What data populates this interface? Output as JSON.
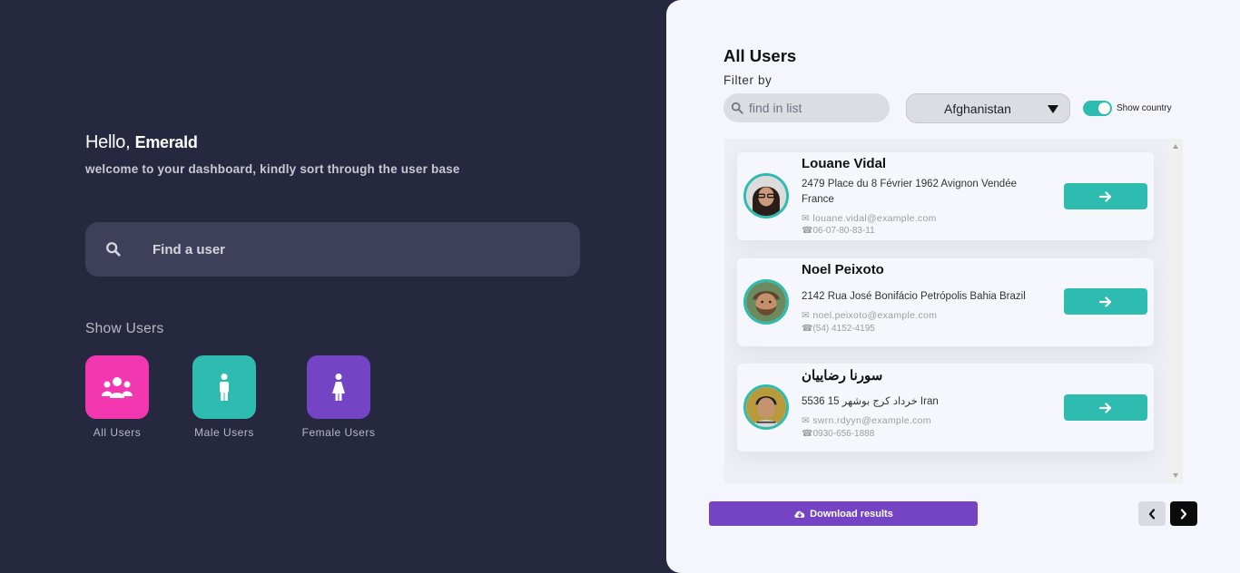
{
  "greeting": {
    "hello": "Hello,",
    "name": "Emerald",
    "welcome": "welcome to your dashboard, kindly sort through the user base"
  },
  "search": {
    "placeholder": "Find a user"
  },
  "show_users": {
    "heading": "Show Users",
    "categories": [
      {
        "label": "All Users",
        "color": "#f337b1",
        "icon": "users-icon"
      },
      {
        "label": "Male Users",
        "color": "#2fbcb0",
        "icon": "male-icon"
      },
      {
        "label": "Female Users",
        "color": "#7444c4",
        "icon": "female-icon"
      }
    ]
  },
  "panel": {
    "title": "All Users",
    "filter_by": "Filter by",
    "find_placeholder": "find in list",
    "country": "Afghanistan",
    "toggle_label": "Show country",
    "toggle_on": true
  },
  "users": [
    {
      "name": "Louane Vidal",
      "address": "2479 Place du 8 Février 1962 Avignon Vendée France",
      "email": "louane.vidal@example.com",
      "phone": "06-07-80-83-11"
    },
    {
      "name": "Noel Peixoto",
      "address": "2142 Rua José Bonifácio Petrópolis Bahia Brazil",
      "email": "noel.peixoto@example.com",
      "phone": "(54) 4152-4195"
    },
    {
      "name": "سورنا رضاییان",
      "address": "5536 15 خرداد کرج بوشهر Iran",
      "email": "swrn.rdyyn@example.com",
      "phone": "0930-656-1888"
    }
  ],
  "footer": {
    "download_label": "Download results"
  },
  "colors": {
    "accent": "#2fbcb0",
    "purple": "#7444c4",
    "pink": "#f337b1",
    "dark_bg": "#262840"
  }
}
